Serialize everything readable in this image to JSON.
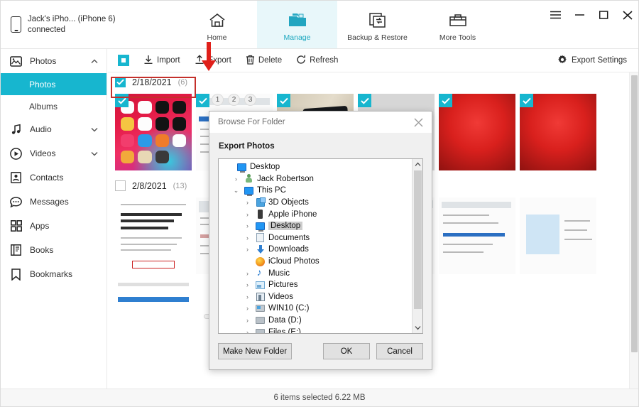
{
  "window": {
    "device_name": "Jack's iPho... (iPhone 6)",
    "device_status": "connected",
    "controls": {
      "menu": "menu-icon",
      "minimize": "minimize-icon",
      "maximize": "maximize-icon",
      "close": "close-icon"
    }
  },
  "nav_tabs": [
    {
      "id": "home",
      "label": "Home",
      "icon": "home-icon",
      "active": false
    },
    {
      "id": "manage",
      "label": "Manage",
      "icon": "folder-manage-icon",
      "active": true
    },
    {
      "id": "backup",
      "label": "Backup & Restore",
      "icon": "backup-restore-icon",
      "active": false
    },
    {
      "id": "tools",
      "label": "More Tools",
      "icon": "toolbox-icon",
      "active": false
    }
  ],
  "sidebar": {
    "items": [
      {
        "id": "photos",
        "label": "Photos",
        "icon": "photo-icon",
        "chevron": "chevron-up",
        "expanded": true
      },
      {
        "id": "audio",
        "label": "Audio",
        "icon": "music-note-icon",
        "chevron": "chevron-down",
        "expanded": false
      },
      {
        "id": "videos",
        "label": "Videos",
        "icon": "play-circle-icon",
        "chevron": "chevron-down",
        "expanded": false
      },
      {
        "id": "contacts",
        "label": "Contacts",
        "icon": "contact-card-icon",
        "chevron": "",
        "expanded": false
      },
      {
        "id": "messages",
        "label": "Messages",
        "icon": "chat-bubble-icon",
        "chevron": "",
        "expanded": false
      },
      {
        "id": "apps",
        "label": "Apps",
        "icon": "grid-apps-icon",
        "chevron": "",
        "expanded": false
      },
      {
        "id": "books",
        "label": "Books",
        "icon": "book-icon",
        "chevron": "",
        "expanded": false
      },
      {
        "id": "bookmarks",
        "label": "Bookmarks",
        "icon": "bookmark-icon",
        "chevron": "",
        "expanded": false
      }
    ],
    "sub_items": [
      {
        "id": "photos-sub",
        "label": "Photos",
        "active": true
      },
      {
        "id": "albums-sub",
        "label": "Albums",
        "active": false
      }
    ]
  },
  "toolbar": {
    "select_all": "select-all-checkbox",
    "import_label": "Import",
    "export_label": "Export",
    "delete_label": "Delete",
    "refresh_label": "Refresh",
    "export_settings_label": "Export Settings"
  },
  "content": {
    "groups": [
      {
        "date": "2/18/2021",
        "count": "(6)",
        "checked": true
      },
      {
        "date": "2/8/2021",
        "count": "(13)",
        "checked": false
      }
    ],
    "step_badges": [
      "1",
      "2",
      "3"
    ]
  },
  "dialog": {
    "title": "Browse For Folder",
    "close_icon": "close-icon",
    "subtitle": "Export Photos",
    "tree": [
      {
        "label": "Desktop",
        "indent": 0,
        "expander": "",
        "icon": "monitor-icon",
        "selected": false
      },
      {
        "label": "Jack Robertson",
        "indent": 1,
        "expander": "›",
        "icon": "user-icon",
        "selected": false
      },
      {
        "label": "This PC",
        "indent": 1,
        "expander": "⌄",
        "icon": "monitor-icon",
        "selected": false
      },
      {
        "label": "3D Objects",
        "indent": 2,
        "expander": "›",
        "icon": "3d-objects-icon",
        "selected": false
      },
      {
        "label": "Apple iPhone",
        "indent": 2,
        "expander": "›",
        "icon": "iphone-icon",
        "selected": false
      },
      {
        "label": "Desktop",
        "indent": 2,
        "expander": "›",
        "icon": "monitor-icon",
        "selected": true
      },
      {
        "label": "Documents",
        "indent": 2,
        "expander": "›",
        "icon": "documents-icon",
        "selected": false
      },
      {
        "label": "Downloads",
        "indent": 2,
        "expander": "›",
        "icon": "downloads-icon",
        "selected": false
      },
      {
        "label": "iCloud Photos",
        "indent": 2,
        "expander": "",
        "icon": "icloud-photos-icon",
        "selected": false
      },
      {
        "label": "Music",
        "indent": 2,
        "expander": "›",
        "icon": "music-icon",
        "selected": false
      },
      {
        "label": "Pictures",
        "indent": 2,
        "expander": "›",
        "icon": "pictures-icon",
        "selected": false
      },
      {
        "label": "Videos",
        "indent": 2,
        "expander": "›",
        "icon": "videos-icon",
        "selected": false
      },
      {
        "label": "WIN10 (C:)",
        "indent": 2,
        "expander": "›",
        "icon": "windows-drive-icon",
        "selected": false
      },
      {
        "label": "Data (D:)",
        "indent": 2,
        "expander": "›",
        "icon": "drive-icon",
        "selected": false
      },
      {
        "label": "Files (E:)",
        "indent": 2,
        "expander": "›",
        "icon": "drive-icon",
        "selected": false
      }
    ],
    "buttons": {
      "make_new_folder": "Make New Folder",
      "ok": "OK",
      "cancel": "Cancel"
    }
  },
  "status_bar": {
    "text": "6 items selected 6.22 MB"
  },
  "colors": {
    "accent": "#17b6cf",
    "accent_tab_bg": "#e8f7fa",
    "highlight_red": "#c4302b",
    "arrow_red": "#e0201a"
  }
}
